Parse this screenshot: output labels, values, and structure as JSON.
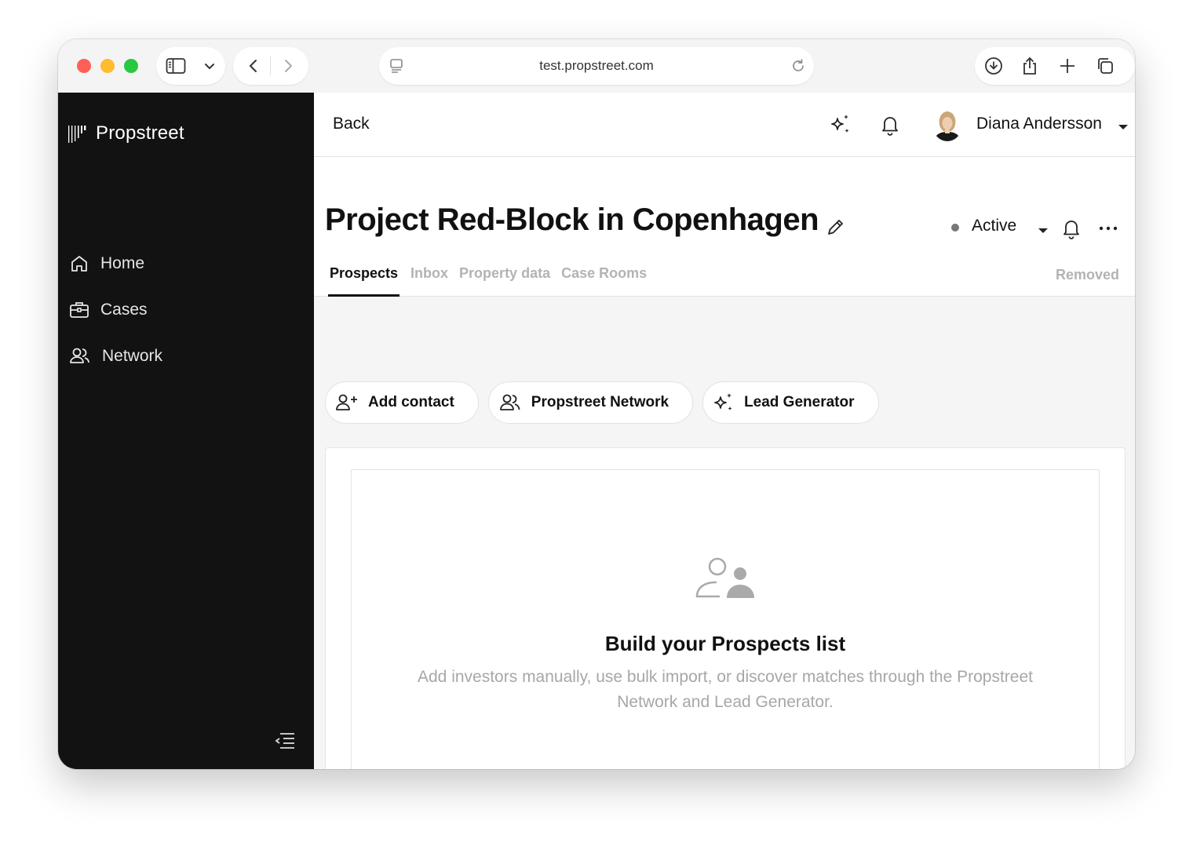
{
  "browser": {
    "url": "test.propstreet.com"
  },
  "sidebar": {
    "logo": "Propstreet",
    "items": [
      {
        "label": "Home",
        "icon": "home-icon"
      },
      {
        "label": "Cases",
        "icon": "briefcase-icon"
      },
      {
        "label": "Network",
        "icon": "users-icon"
      }
    ]
  },
  "topbar": {
    "back_label": "Back",
    "user_name": "Diana Andersson"
  },
  "project": {
    "title": "Project Red-Block in Copenhagen",
    "status": "Active",
    "tabs": [
      "Prospects",
      "Inbox",
      "Property data",
      "Case Rooms"
    ],
    "active_tab": "Prospects",
    "removed_label": "Removed"
  },
  "actions": {
    "add_contact": "Add contact",
    "network": "Propstreet Network",
    "lead_generator": "Lead Generator"
  },
  "empty_state": {
    "title": "Build your Prospects list",
    "description": "Add investors manually, use bulk import, or discover matches through the Propstreet Network and Lead Generator."
  },
  "colors": {
    "sidebar_bg": "#121212",
    "traffic_red": "#fe5f57",
    "traffic_yellow": "#febc2e",
    "traffic_green": "#28c840"
  }
}
